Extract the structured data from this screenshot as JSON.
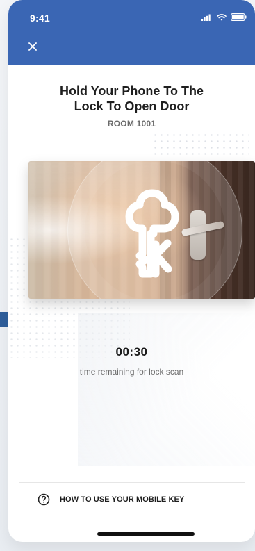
{
  "status_bar": {
    "time": "9:41",
    "icons": [
      "cellular-signal-icon",
      "wifi-icon",
      "battery-icon"
    ]
  },
  "header": {
    "close_icon": "close-icon",
    "background_color": "#3a66b4"
  },
  "content": {
    "title_line1": "Hold Your Phone To The",
    "title_line2": "Lock To Open Door",
    "room": "ROOM 1001",
    "hero": {
      "icon": "key-icon"
    },
    "timer": "00:30",
    "timer_caption": "time remaining for lock scan"
  },
  "help": {
    "icon": "question-circle-icon",
    "label": "HOW TO USE YOUR MOBILE KEY"
  },
  "colors": {
    "accent": "#3a66b4",
    "left_accent": "#2f5f9c"
  }
}
